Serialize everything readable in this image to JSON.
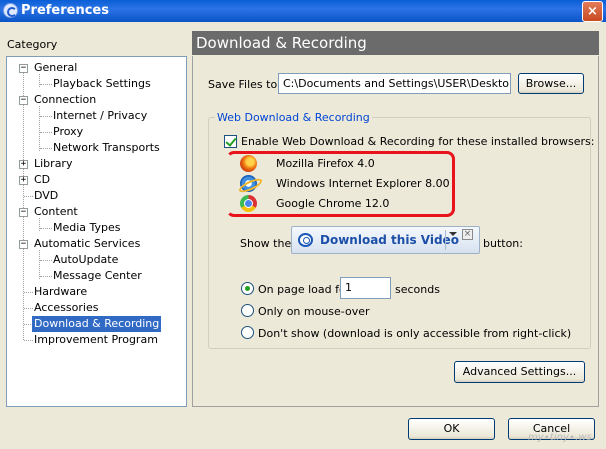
{
  "window": {
    "title": "Preferences",
    "close_glyph": "×"
  },
  "sidebar": {
    "label": "Category",
    "items": [
      {
        "label": "General",
        "expander": "−"
      },
      {
        "label": "Playback Settings"
      },
      {
        "label": "Connection",
        "expander": "−"
      },
      {
        "label": "Internet / Privacy"
      },
      {
        "label": "Proxy"
      },
      {
        "label": "Network Transports"
      },
      {
        "label": "Library",
        "expander": "+"
      },
      {
        "label": "CD",
        "expander": "+"
      },
      {
        "label": "DVD"
      },
      {
        "label": "Content",
        "expander": "−"
      },
      {
        "label": "Media Types"
      },
      {
        "label": "Automatic Services",
        "expander": "−"
      },
      {
        "label": "AutoUpdate"
      },
      {
        "label": "Message Center"
      },
      {
        "label": "Hardware"
      },
      {
        "label": "Accessories"
      },
      {
        "label": "Download & Recording",
        "selected": true
      },
      {
        "label": "Improvement Program"
      }
    ]
  },
  "panel": {
    "title": "Download & Recording",
    "save_files_label": "Save Files to:",
    "save_path": "C:\\Documents and Settings\\USER\\Desktop",
    "browse_label": "Browse...",
    "group_title": "Web Download & Recording",
    "enable_label": "Enable Web Download & Recording for these installed browsers:",
    "enable_checked": true,
    "browsers": [
      {
        "name": "Mozilla Firefox 4.0",
        "icon": "firefox-icon"
      },
      {
        "name": "Windows Internet Explorer 8.00",
        "icon": "internet-explorer-icon"
      },
      {
        "name": "Google Chrome 12.0",
        "icon": "chrome-icon"
      }
    ],
    "show_the_label": "Show the",
    "download_button_label": "Download this Video",
    "button_suffix": "button:",
    "radio_options": {
      "on_page_load": "On page load for",
      "seconds_value": "1",
      "seconds_label": "seconds",
      "mouse_over": "Only on mouse-over",
      "dont_show": "Don't show (download is only accessible from right-click)"
    },
    "selected_radio": "on_page_load",
    "advanced_label": "Advanced Settings..."
  },
  "footer": {
    "ok_label": "OK",
    "cancel_label": "Cancel"
  },
  "colors": {
    "title_blue": "#0a5fd6",
    "header_gray": "#6b6b6b",
    "selection": "#316ac5",
    "highlight_red": "#e8131b",
    "group_title": "#0046d5"
  }
}
